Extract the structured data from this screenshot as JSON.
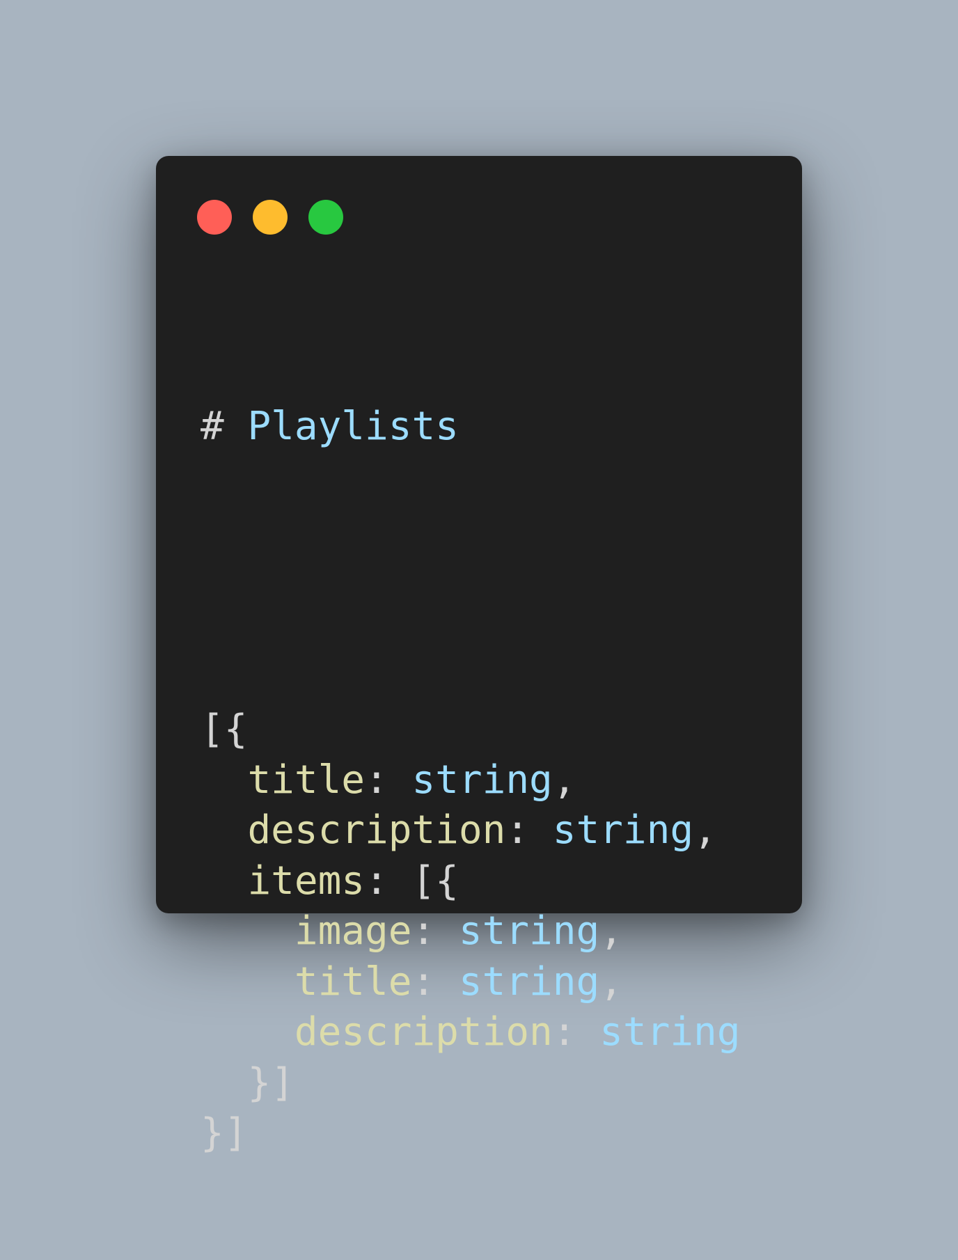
{
  "colors": {
    "page_background": "#a8b4c0",
    "window_background": "#1f1f1f",
    "close_dot": "#ff5f57",
    "minimize_dot": "#febc2e",
    "zoom_dot": "#28c840",
    "key_color": "#dcdcaa",
    "type_color": "#9cdcfe",
    "punct_color": "#d4d4d4"
  },
  "window_controls": {
    "close": "close-dot",
    "minimize": "minimize-dot",
    "zoom": "zoom-dot"
  },
  "code": {
    "heading_mark": "# ",
    "heading_text": "Playlists",
    "lines": [
      {
        "indent": "",
        "open": "[{"
      },
      {
        "indent": "  ",
        "key": "title",
        "colon": ": ",
        "type": "string",
        "trail": ","
      },
      {
        "indent": "  ",
        "key": "description",
        "colon": ": ",
        "type": "string",
        "trail": ","
      },
      {
        "indent": "  ",
        "key": "items",
        "colon": ": ",
        "open": "[{"
      },
      {
        "indent": "    ",
        "key": "image",
        "colon": ": ",
        "type": "string",
        "trail": ","
      },
      {
        "indent": "    ",
        "key": "title",
        "colon": ": ",
        "type": "string",
        "trail": ","
      },
      {
        "indent": "    ",
        "key": "description",
        "colon": ": ",
        "type": "string",
        "trail": ""
      },
      {
        "indent": "  ",
        "close": "}]"
      },
      {
        "indent": "",
        "close": "}]"
      }
    ]
  }
}
